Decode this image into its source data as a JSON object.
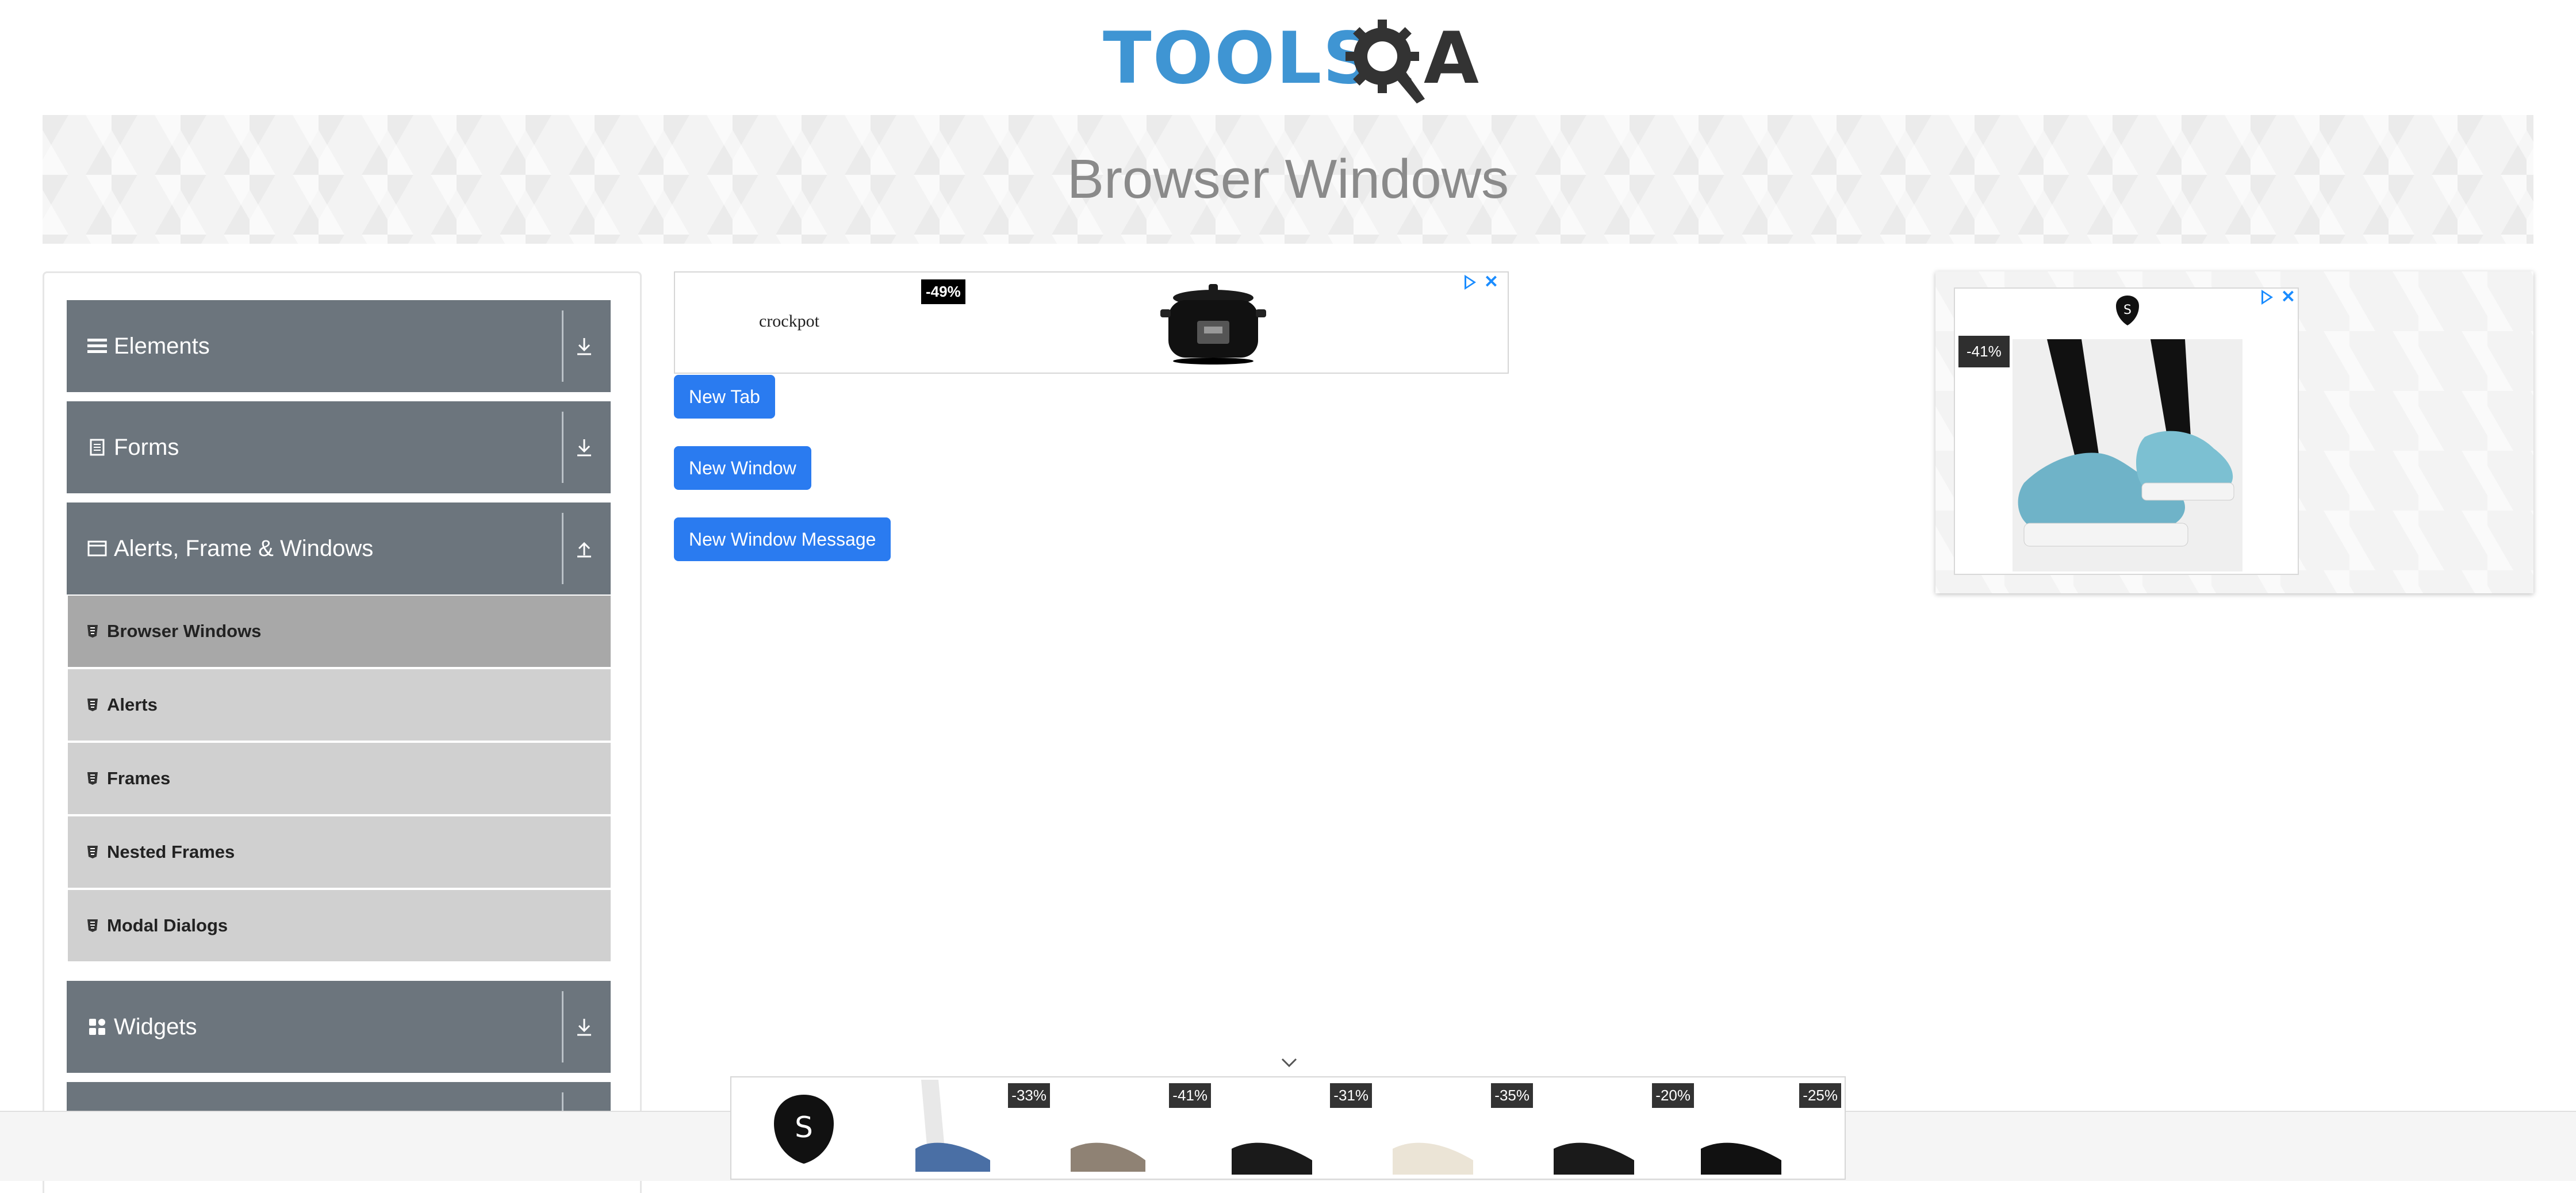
{
  "header": {
    "logo_text_tools": "TOOLS",
    "logo_text_q": "Q",
    "logo_text_a": "A"
  },
  "banner": {
    "title": "Browser Windows"
  },
  "sidebar": {
    "groups": [
      {
        "label": "Elements",
        "icon": "hamburger-icon",
        "arrow": "download-icon"
      },
      {
        "label": "Forms",
        "icon": "document-icon",
        "arrow": "download-icon"
      },
      {
        "label": "Alerts, Frame & Windows",
        "icon": "window-icon",
        "arrow": "upload-icon"
      },
      {
        "label": "Widgets",
        "icon": "grid-icon",
        "arrow": "download-icon"
      }
    ],
    "items": [
      {
        "label": "Browser Windows",
        "active": true
      },
      {
        "label": "Alerts"
      },
      {
        "label": "Frames"
      },
      {
        "label": "Nested Frames"
      },
      {
        "label": "Modal Dialogs"
      }
    ]
  },
  "main": {
    "ad": {
      "brand": "crockpot",
      "discount": "-49%"
    },
    "buttons": {
      "new_tab": "New Tab",
      "new_window": "New Window",
      "new_window_message": "New Window Message"
    }
  },
  "right_ad": {
    "discount": "-41%"
  },
  "bottom_ad": {
    "discounts": [
      "-33%",
      "-41%",
      "-31%",
      "-35%",
      "-20%",
      "-25%"
    ]
  },
  "colors": {
    "sidebar_header": "#6c757d",
    "button": "#2a7bf0",
    "logo_blue": "#3f95d3"
  }
}
